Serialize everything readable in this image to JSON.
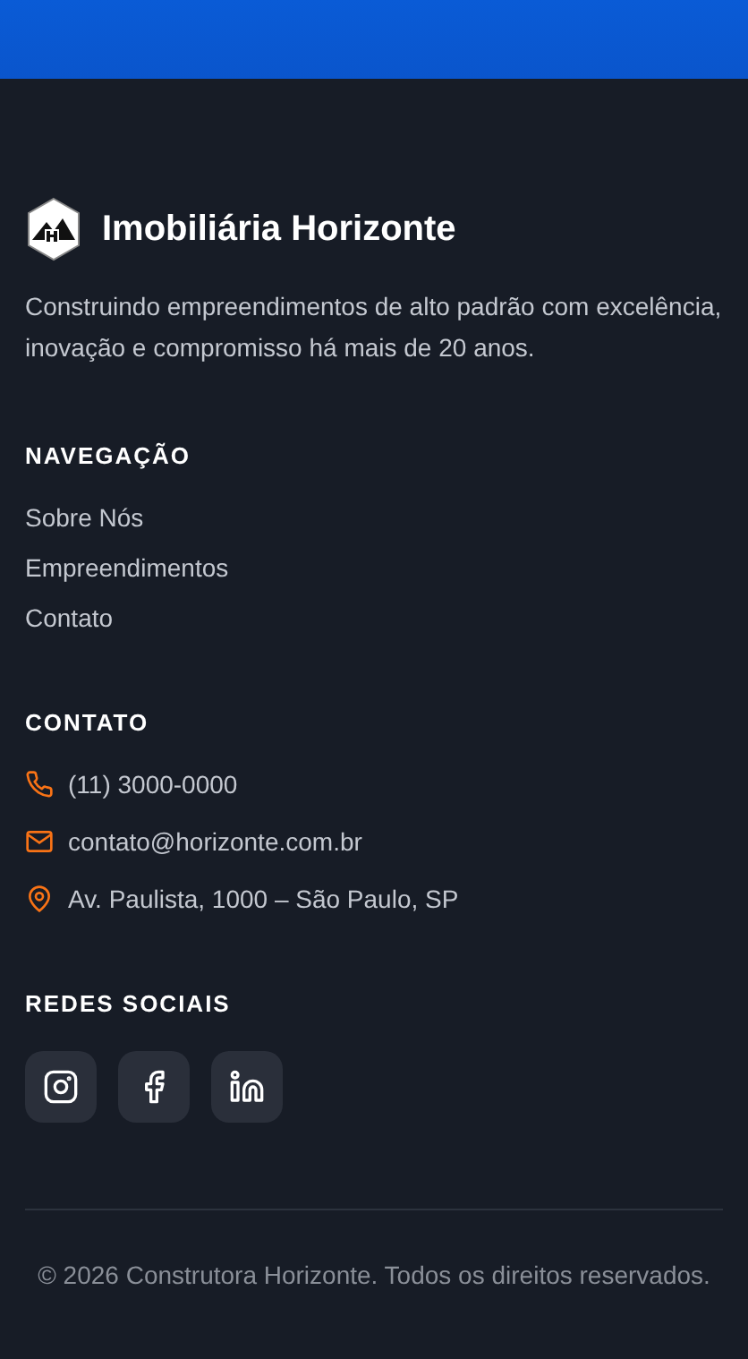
{
  "brand": {
    "name": "Imobiliária Horizonte",
    "description": "Construindo empreendimentos de alto padrão com excelência, inovação e compromisso há mais de 20 anos."
  },
  "navigation": {
    "title": "NAVEGAÇÃO",
    "links": [
      "Sobre Nós",
      "Empreendimentos",
      "Contato"
    ]
  },
  "contact": {
    "title": "CONTATO",
    "items": [
      {
        "kind": "phone",
        "text": "(11) 3000-0000"
      },
      {
        "kind": "email",
        "text": "contato@horizonte.com.br"
      },
      {
        "kind": "location",
        "text": "Av. Paulista, 1000 – São Paulo, SP"
      }
    ]
  },
  "social": {
    "title": "REDES SOCIAIS",
    "items": [
      {
        "kind": "instagram"
      },
      {
        "kind": "facebook"
      },
      {
        "kind": "linkedin"
      }
    ]
  },
  "copyright": "© 2026 Construtora Horizonte. Todos os direitos reservados."
}
